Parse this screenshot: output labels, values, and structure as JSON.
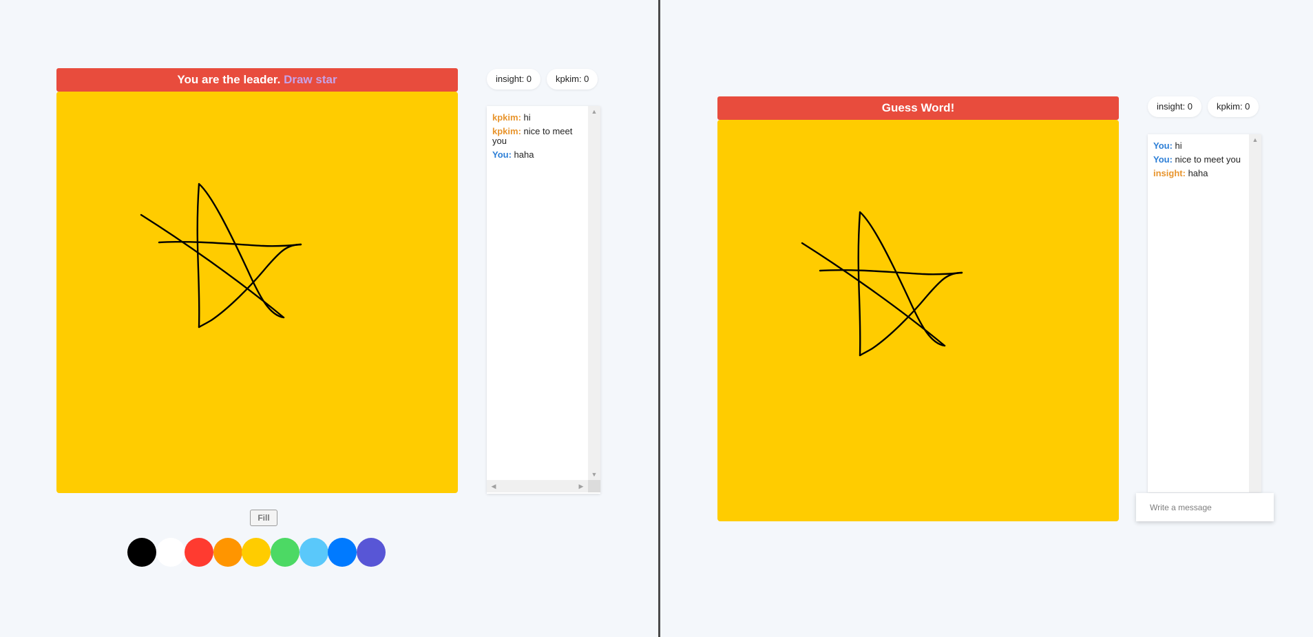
{
  "left": {
    "banner": {
      "text": "You are the leader.",
      "word": "Draw star"
    },
    "scores": [
      "insight: 0",
      "kpkim: 0"
    ],
    "chat": [
      {
        "author": "kpkim:",
        "role": "other",
        "text": "hi"
      },
      {
        "author": "kpkim:",
        "role": "other",
        "text": "nice to meet you"
      },
      {
        "author": "You:",
        "role": "self",
        "text": "haha"
      }
    ],
    "fill_label": "Fill",
    "palette": [
      "#000000",
      "#ffffff",
      "#ff3b30",
      "#ff9500",
      "#ffcc00",
      "#4cd964",
      "#5ac8fa",
      "#007aff",
      "#5856d6"
    ]
  },
  "right": {
    "banner": {
      "text": "Guess Word!"
    },
    "scores": [
      "insight: 0",
      "kpkim: 0"
    ],
    "chat": [
      {
        "author": "You:",
        "role": "self",
        "text": "hi"
      },
      {
        "author": "You:",
        "role": "self",
        "text": "nice to meet you"
      },
      {
        "author": "insight:",
        "role": "other",
        "text": "haha"
      }
    ],
    "input_placeholder": "Write a message"
  },
  "colors": {
    "banner": "#e84c3d",
    "canvas": "#ffcc00",
    "leader_word": "#c7a2e8",
    "author_other": "#e8942c",
    "author_self": "#2c7ed6"
  },
  "icons": {
    "scroll_up": "triangle-up",
    "scroll_down": "triangle-down",
    "scroll_left": "triangle-left",
    "scroll_right": "triangle-right"
  }
}
